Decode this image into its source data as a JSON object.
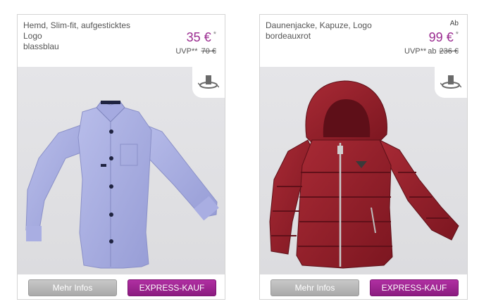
{
  "products": [
    {
      "name": "Hemd, Slim-fit, aufgesticktes Logo",
      "color": "blassblau",
      "price": "35 €",
      "price_star": "*",
      "uvp_label": "UVP**",
      "uvp_value": "70 €",
      "more_label": "Mehr Infos",
      "express_label": "EXPRESS-KAUF",
      "rotate_icon": "360-rotate-icon"
    },
    {
      "name": "Daunenjacke, Kapuze, Logo",
      "color": "bordeauxrot",
      "price_prefix": "Ab",
      "price": "99 €",
      "price_star": "*",
      "uvp_label": "UVP**",
      "uvp_prefix": "ab",
      "uvp_value": "236 €",
      "more_label": "Mehr Infos",
      "express_label": "EXPRESS-KAUF",
      "rotate_icon": "360-rotate-icon"
    }
  ],
  "colors": {
    "accent": "#9a2a8f",
    "express_button": "#9e2493",
    "more_button": "#b5b5b5"
  }
}
